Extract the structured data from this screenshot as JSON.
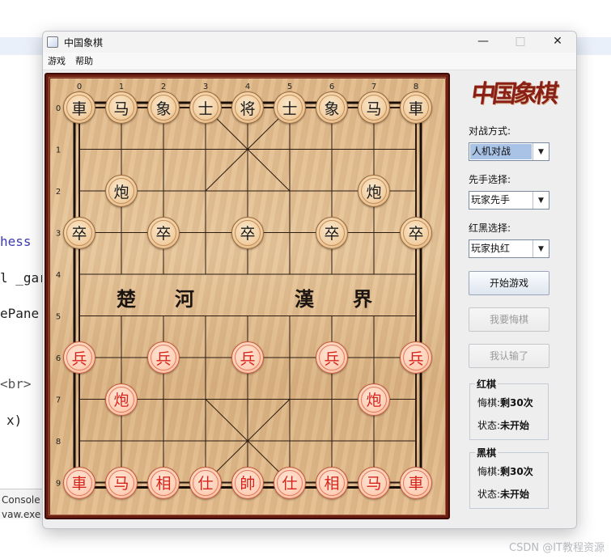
{
  "background": {
    "code_fragments": [
      "hess",
      "l _gar",
      "ePane",
      "<br>",
      "x)"
    ],
    "console_tab": "Console",
    "console_line": "vaw.exe (",
    "watermark": "CSDN @IT教程资源"
  },
  "window": {
    "title": "中国象棋",
    "minimize": "—",
    "maximize": "□",
    "close": "✕"
  },
  "menu": {
    "game": "游戏",
    "help": "帮助"
  },
  "board": {
    "column_labels": [
      "0",
      "1",
      "2",
      "3",
      "4",
      "5",
      "6",
      "7",
      "8"
    ],
    "row_labels": [
      "0",
      "1",
      "2",
      "3",
      "4",
      "5",
      "6",
      "7",
      "8",
      "9"
    ],
    "river_left": [
      "楚",
      "河"
    ],
    "river_right": [
      "漢",
      "界"
    ],
    "pieces": [
      {
        "side": "black",
        "char": "車",
        "col": 0,
        "row": 0
      },
      {
        "side": "black",
        "char": "马",
        "col": 1,
        "row": 0
      },
      {
        "side": "black",
        "char": "象",
        "col": 2,
        "row": 0
      },
      {
        "side": "black",
        "char": "士",
        "col": 3,
        "row": 0
      },
      {
        "side": "black",
        "char": "将",
        "col": 4,
        "row": 0
      },
      {
        "side": "black",
        "char": "士",
        "col": 5,
        "row": 0
      },
      {
        "side": "black",
        "char": "象",
        "col": 6,
        "row": 0
      },
      {
        "side": "black",
        "char": "马",
        "col": 7,
        "row": 0
      },
      {
        "side": "black",
        "char": "車",
        "col": 8,
        "row": 0
      },
      {
        "side": "black",
        "char": "炮",
        "col": 1,
        "row": 2
      },
      {
        "side": "black",
        "char": "炮",
        "col": 7,
        "row": 2
      },
      {
        "side": "black",
        "char": "卒",
        "col": 0,
        "row": 3
      },
      {
        "side": "black",
        "char": "卒",
        "col": 2,
        "row": 3
      },
      {
        "side": "black",
        "char": "卒",
        "col": 4,
        "row": 3
      },
      {
        "side": "black",
        "char": "卒",
        "col": 6,
        "row": 3
      },
      {
        "side": "black",
        "char": "卒",
        "col": 8,
        "row": 3
      },
      {
        "side": "red",
        "char": "兵",
        "col": 0,
        "row": 6
      },
      {
        "side": "red",
        "char": "兵",
        "col": 2,
        "row": 6
      },
      {
        "side": "red",
        "char": "兵",
        "col": 4,
        "row": 6
      },
      {
        "side": "red",
        "char": "兵",
        "col": 6,
        "row": 6
      },
      {
        "side": "red",
        "char": "兵",
        "col": 8,
        "row": 6
      },
      {
        "side": "red",
        "char": "炮",
        "col": 1,
        "row": 7
      },
      {
        "side": "red",
        "char": "炮",
        "col": 7,
        "row": 7
      },
      {
        "side": "red",
        "char": "車",
        "col": 0,
        "row": 9
      },
      {
        "side": "red",
        "char": "马",
        "col": 1,
        "row": 9
      },
      {
        "side": "red",
        "char": "相",
        "col": 2,
        "row": 9
      },
      {
        "side": "red",
        "char": "仕",
        "col": 3,
        "row": 9
      },
      {
        "side": "red",
        "char": "帥",
        "col": 4,
        "row": 9
      },
      {
        "side": "red",
        "char": "仕",
        "col": 5,
        "row": 9
      },
      {
        "side": "red",
        "char": "相",
        "col": 6,
        "row": 9
      },
      {
        "side": "red",
        "char": "马",
        "col": 7,
        "row": 9
      },
      {
        "side": "red",
        "char": "車",
        "col": 8,
        "row": 9
      }
    ]
  },
  "side_panel": {
    "logo": "中国象棋",
    "mode_label": "对战方式:",
    "mode_value": "人机对战",
    "first_label": "先手选择:",
    "first_value": "玩家先手",
    "color_label": "红黑选择:",
    "color_value": "玩家执红",
    "start_button": "开始游戏",
    "undo_button": "我要悔棋",
    "resign_button": "我认输了",
    "red_group": {
      "title": "红棋",
      "undo_label": "悔棋:",
      "undo_value": "剩30次",
      "status_label": "状态:",
      "status_value": "未开始"
    },
    "black_group": {
      "title": "黑棋",
      "undo_label": "悔棋:",
      "undo_value": "剩30次",
      "status_label": "状态:",
      "status_value": "未开始"
    }
  }
}
